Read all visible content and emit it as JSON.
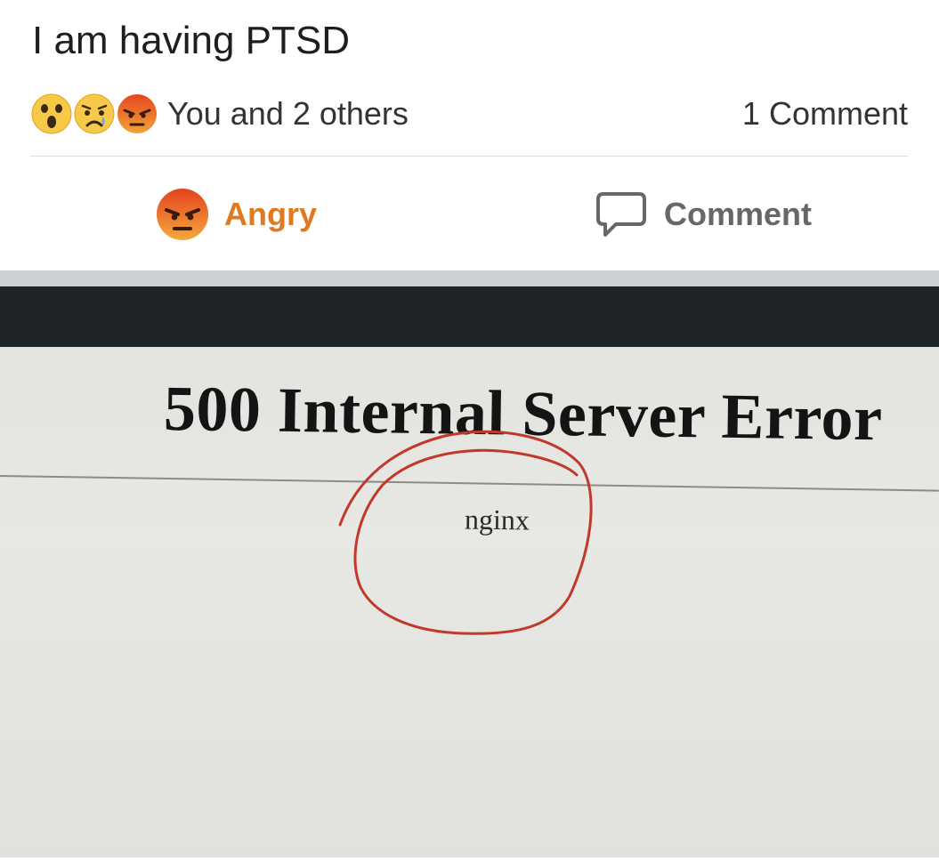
{
  "post": {
    "text": "I am having PTSD"
  },
  "reactions": {
    "icons": [
      "surprised-emoji-icon",
      "sad-tear-emoji-icon",
      "angry-emoji-icon"
    ],
    "summary": "You and 2 others",
    "comments": "1 Comment"
  },
  "actions": {
    "reaction_label": "Angry",
    "comment_label": "Comment"
  },
  "photo": {
    "error_title": "500 Internal Server Error",
    "server": "nginx",
    "annotation_color": "#c0392b"
  },
  "colors": {
    "angry_accent": "#e17a1f",
    "muted_text": "#65676b",
    "divider": "#dadde1"
  }
}
